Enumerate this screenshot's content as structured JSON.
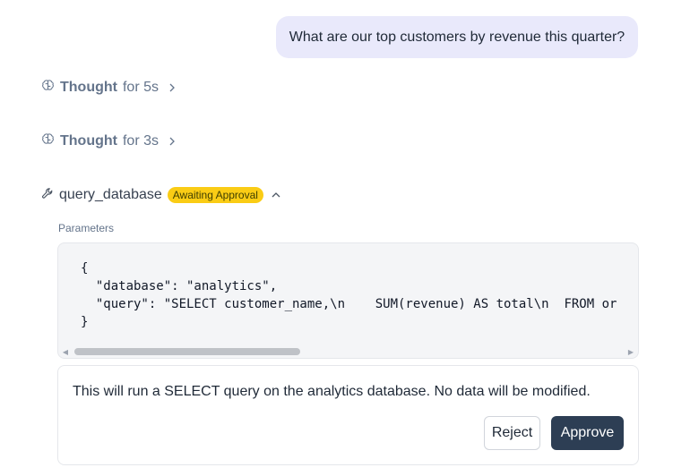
{
  "user_message": "What are our top customers by revenue this quarter?",
  "thoughts": [
    {
      "label": "Thought",
      "duration": "for 5s",
      "icon": "brain-icon"
    },
    {
      "label": "Thought",
      "duration": "for 3s",
      "icon": "brain-icon"
    }
  ],
  "tool_call": {
    "icon": "wrench-icon",
    "name": "query_database",
    "status_badge": "Awaiting Approval",
    "badge_color": "#facc15",
    "params_label": "Parameters",
    "code_lines": [
      "{",
      "  \"database\": \"analytics\",",
      "  \"query\": \"SELECT customer_name,\\n    SUM(revenue) AS total\\n  FROM or",
      "}"
    ]
  },
  "approval": {
    "message": "This will run a SELECT query on the analytics database. No data will be modified.",
    "reject_label": "Reject",
    "approve_label": "Approve",
    "approve_color": "#2d3e54"
  }
}
